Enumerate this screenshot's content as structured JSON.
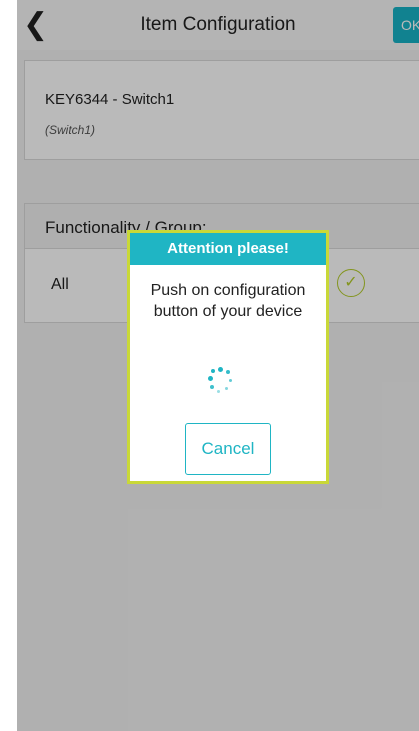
{
  "navbar": {
    "title": "Item Configuration",
    "back_icon": "chevron-left-icon",
    "ok_label": "OK"
  },
  "item": {
    "name": "KEY6344 - Switch1",
    "subtitle": "(Switch1)"
  },
  "functionality": {
    "header": "Functionality / Group:",
    "rows": [
      {
        "label": "All",
        "icon": "check-circle-icon"
      }
    ]
  },
  "dialog": {
    "title": "Attention please!",
    "message": "Push on configuration button of your device",
    "spinner_icon": "loading-spinner-icon",
    "cancel_label": "Cancel"
  },
  "colors": {
    "accent": "#1fb5c4",
    "dialog_border": "#c9d838",
    "check": "#b4cc2a"
  }
}
